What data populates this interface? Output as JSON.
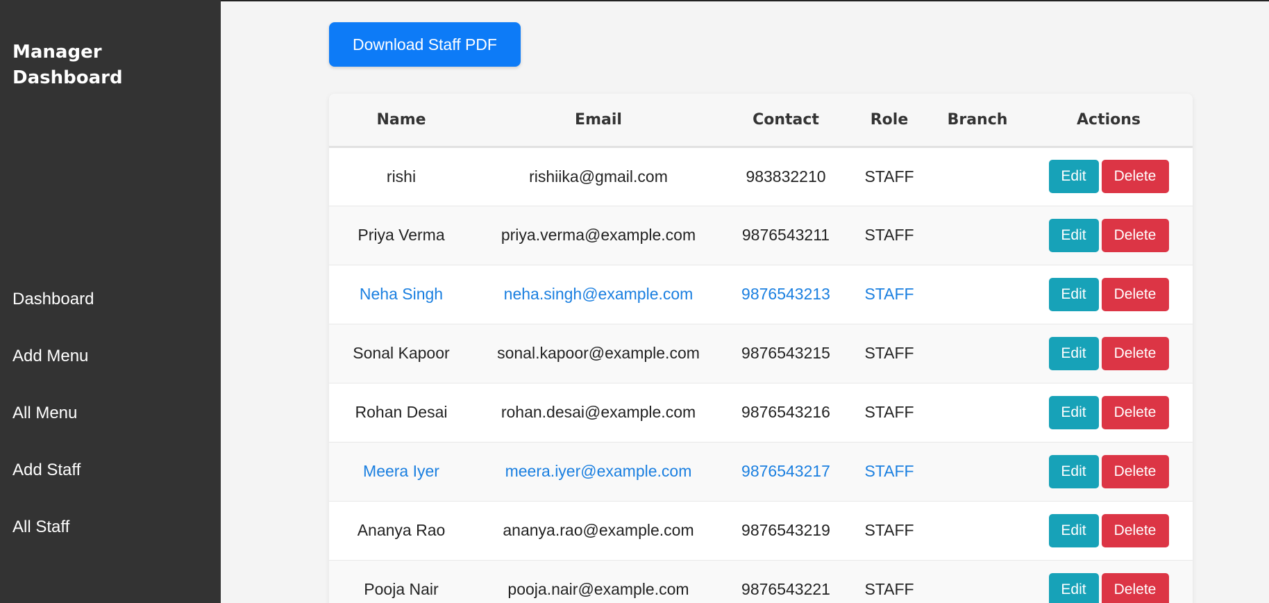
{
  "sidebar": {
    "title": "Manager Dashboard",
    "items": [
      {
        "label": "Dashboard"
      },
      {
        "label": "Add Menu"
      },
      {
        "label": "All Menu"
      },
      {
        "label": "Add Staff"
      },
      {
        "label": "All Staff"
      }
    ],
    "background": "#333333"
  },
  "toolbar": {
    "download_label": "Download Staff PDF",
    "accent": "#0d7bf7"
  },
  "table": {
    "headers": {
      "name": "Name",
      "email": "Email",
      "contact": "Contact",
      "role": "Role",
      "branch": "Branch",
      "actions": "Actions"
    },
    "rows": [
      {
        "name": "rishi",
        "email": "rishiika@gmail.com",
        "contact": "983832210",
        "role": "STAFF",
        "branch": "",
        "edit": "Edit",
        "delete": "Delete",
        "highlighted": false
      },
      {
        "name": "Priya Verma",
        "email": "priya.verma@example.com",
        "contact": "9876543211",
        "role": "STAFF",
        "branch": "",
        "edit": "Edit",
        "delete": "Delete",
        "highlighted": false
      },
      {
        "name": "Neha Singh",
        "email": "neha.singh@example.com",
        "contact": "9876543213",
        "role": "STAFF",
        "branch": "",
        "edit": "Edit",
        "delete": "Delete",
        "highlighted": true
      },
      {
        "name": "Sonal Kapoor",
        "email": "sonal.kapoor@example.com",
        "contact": "9876543215",
        "role": "STAFF",
        "branch": "",
        "edit": "Edit",
        "delete": "Delete",
        "highlighted": false
      },
      {
        "name": "Rohan Desai",
        "email": "rohan.desai@example.com",
        "contact": "9876543216",
        "role": "STAFF",
        "branch": "",
        "edit": "Edit",
        "delete": "Delete",
        "highlighted": false
      },
      {
        "name": "Meera Iyer",
        "email": "meera.iyer@example.com",
        "contact": "9876543217",
        "role": "STAFF",
        "branch": "",
        "edit": "Edit",
        "delete": "Delete",
        "highlighted": true
      },
      {
        "name": "Ananya Rao",
        "email": "ananya.rao@example.com",
        "contact": "9876543219",
        "role": "STAFF",
        "branch": "",
        "edit": "Edit",
        "delete": "Delete",
        "highlighted": false
      },
      {
        "name": "Pooja Nair",
        "email": "pooja.nair@example.com",
        "contact": "9876543221",
        "role": "STAFF",
        "branch": "",
        "edit": "Edit",
        "delete": "Delete",
        "highlighted": false
      }
    ],
    "colors": {
      "edit": "#17a2b8",
      "delete": "#dc3545",
      "highlight_text": "#1a7fe0"
    }
  }
}
